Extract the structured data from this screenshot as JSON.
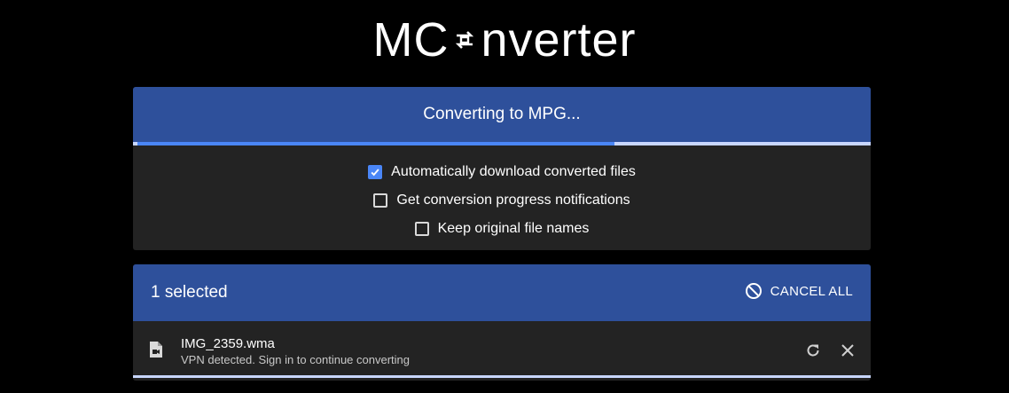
{
  "app": {
    "logo_left": "MC",
    "logo_right": "nverter"
  },
  "conversion": {
    "status_text": "Converting to MPG...",
    "progress_fraction": 0.65
  },
  "options": [
    {
      "label": "Automatically download converted files",
      "checked": true
    },
    {
      "label": "Get conversion progress notifications",
      "checked": false
    },
    {
      "label": "Keep original file names",
      "checked": false
    }
  ],
  "queue": {
    "selected_label": "1 selected",
    "cancel_all_label": "CANCEL ALL",
    "files": [
      {
        "name": "IMG_2359.wma",
        "status": "VPN detected. Sign in to continue converting",
        "icon": "file-video-icon"
      }
    ]
  },
  "colors": {
    "background": "#000000",
    "header_blue": "#2e509b",
    "card": "#232323",
    "accent": "#4a86f7",
    "track": "#c8d6ff"
  }
}
